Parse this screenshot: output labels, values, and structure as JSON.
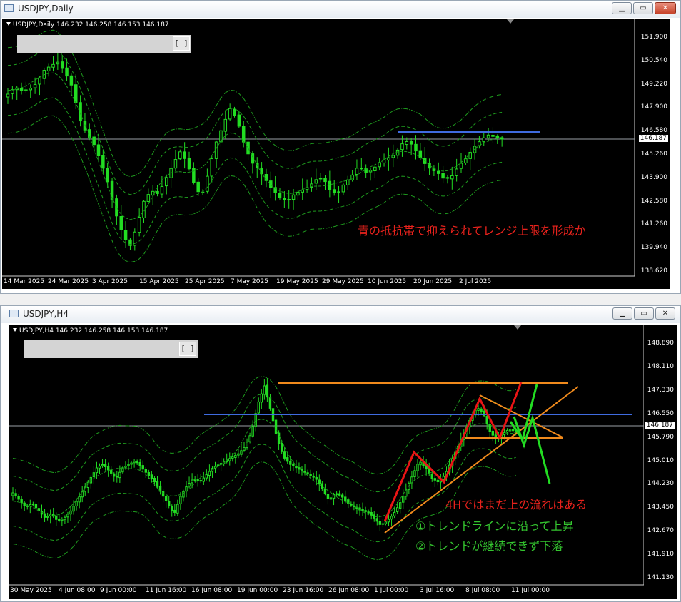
{
  "windows": [
    {
      "id": "daily",
      "title": "USDJPY,Daily",
      "header": "USDJPY,Daily  146.232 146.258 146.153 146.187",
      "y_labels": [
        "151.900",
        "150.540",
        "149.220",
        "147.900",
        "146.580",
        "145.260",
        "143.900",
        "142.580",
        "141.260",
        "139.940",
        "138.620"
      ],
      "current_price": "146.187",
      "x_labels": [
        "14 Mar 2025",
        "24 Mar 2025",
        "3 Apr 2025",
        "15 Apr 2025",
        "25 Apr 2025",
        "7 May 2025",
        "19 May 2025",
        "29 May 2025",
        "10 Jun 2025",
        "20 Jun 2025",
        "2 Jul 2025"
      ],
      "panel_button": "[ ]",
      "annotations": [
        {
          "text": "青の抵抗帯で抑えられてレンジ上限を形成か",
          "color": "#e8221c"
        }
      ]
    },
    {
      "id": "h4",
      "title": "USDJPY,H4",
      "header": "USDJPY,H4  146.232 146.258 146.153 146.187",
      "y_labels": [
        "148.890",
        "148.110",
        "147.330",
        "146.550",
        "145.790",
        "145.010",
        "144.230",
        "143.450",
        "142.670",
        "141.910",
        "141.130"
      ],
      "current_price": "146.187",
      "x_labels": [
        "30 May 2025",
        "4 Jun 08:00",
        "9 Jun 00:00",
        "11 Jun 16:00",
        "16 Jun 08:00",
        "19 Jun 00:00",
        "23 Jun 16:00",
        "26 Jun 08:00",
        "1 Jul 00:00",
        "3 Jul 16:00",
        "8 Jul 08:00",
        "11 Jul 00:00"
      ],
      "panel_button": "[ ]",
      "annotations": [
        {
          "text": "4Hではまだ上の流れはある",
          "color": "#e8221c"
        },
        {
          "text": "①トレンドラインに沿って上昇",
          "color": "#34c52f"
        },
        {
          "text": "②トレンドが継続できず下落",
          "color": "#34c52f"
        }
      ]
    }
  ],
  "colors": {
    "bull": "#22dd22",
    "band": "#1e9b1e",
    "resistance": "#3f6be0",
    "trendline": "#f08a1c",
    "red_path": "#e81515",
    "green_path": "#22dd22"
  },
  "icons": [
    "window-icon",
    "minimize-icon",
    "maximize-icon",
    "close-icon",
    "dropdown-triangle-icon",
    "chart-shift-icon"
  ]
}
